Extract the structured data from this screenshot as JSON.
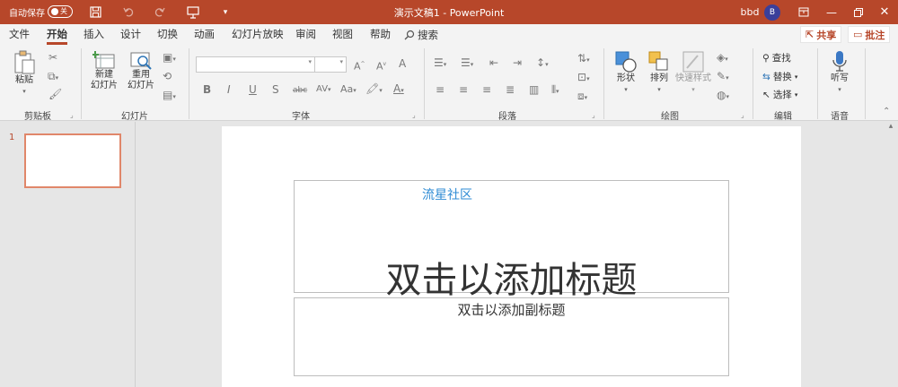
{
  "titlebar": {
    "autosave_label": "自动保存",
    "autosave_state": "关",
    "doc_title": "演示文稿1  -  PowerPoint",
    "user_name": "bbd",
    "avatar_initial": "B",
    "save_icon": "save-icon",
    "undo_icon": "undo-icon",
    "redo_icon": "redo-icon",
    "present_icon": "present-icon",
    "customize_icon": "customize-icon",
    "ribbon_display_icon": "ribbon-display-icon",
    "min_icon": "minimize-icon",
    "restore_icon": "restore-icon",
    "close_icon": "close-icon",
    "bg_color": "#b7472a"
  },
  "tabs": [
    "文件",
    "开始",
    "插入",
    "设计",
    "切换",
    "动画",
    "幻灯片放映",
    "审阅",
    "视图",
    "帮助"
  ],
  "active_tab": "开始",
  "search_label": "搜索",
  "share_label": "共享",
  "comments_label": "批注",
  "ribbon": {
    "clipboard": {
      "paste": "粘贴",
      "group": "剪贴板"
    },
    "slides": {
      "new_slide_1": "新建",
      "new_slide_2": "幻灯片",
      "reuse_1": "重用",
      "reuse_2": "幻灯片",
      "group": "幻灯片"
    },
    "font": {
      "font_name": "",
      "font_size": "",
      "group": "字体",
      "bold": "B",
      "italic": "I",
      "underline": "U",
      "shadow": "S",
      "strike": "abc",
      "spacing": "AV",
      "case": "Aa",
      "grow": "A",
      "shrink": "A",
      "clear": "A"
    },
    "paragraph": {
      "group": "段落"
    },
    "drawing": {
      "shapes": "形状",
      "arrange": "排列",
      "quick_styles": "快速样式",
      "group": "绘图"
    },
    "editing": {
      "find": "查找",
      "replace": "替换",
      "select": "选择",
      "group": "编辑"
    },
    "voice": {
      "dictate": "听写",
      "group": "语音"
    }
  },
  "slides_pane": {
    "slide_number": "1"
  },
  "slide": {
    "watermark": "流星社区",
    "title_placeholder": "双击以添加标题",
    "subtitle_placeholder": "双击以添加副标题"
  }
}
